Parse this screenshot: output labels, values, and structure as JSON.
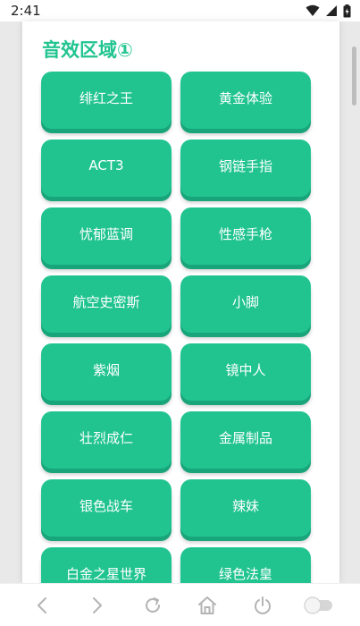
{
  "status_bar": {
    "time": "2:41",
    "icons": [
      "wifi-icon",
      "signal-icon",
      "battery-icon"
    ]
  },
  "section": {
    "title": "音效区域①"
  },
  "sound_buttons": [
    "绯红之王",
    "黄金体验",
    "ACT3",
    "钢链手指",
    "忧郁蓝调",
    "性感手枪",
    "航空史密斯",
    "小脚",
    "紫烟",
    "镜中人",
    "壮烈成仁",
    "金属制品",
    "银色战车",
    "辣妹",
    "白金之星世界",
    "绿色法皇"
  ],
  "nav_bar": {
    "icons": [
      "back-arrow-icon",
      "forward-arrow-icon",
      "refresh-icon",
      "home-icon",
      "power-icon",
      "toggle-icon"
    ]
  },
  "colors": {
    "accent": "#21c48f",
    "accent_shadow": "#19a57a"
  }
}
